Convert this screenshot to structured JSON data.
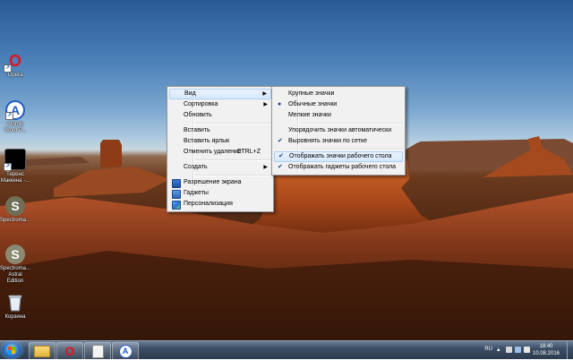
{
  "desktop": {
    "icons": [
      {
        "label": "Opera",
        "icon": "opera-icon"
      },
      {
        "label": "Atomic Word P...",
        "icon": "atomic-word-icon"
      },
      {
        "label": "Теренс Маккена -...",
        "icon": "file-icon"
      },
      {
        "label": "Spectroma...",
        "icon": "spectroma-icon"
      },
      {
        "label": "Spectroma... Astral Edition",
        "icon": "spectroma-astral-icon"
      },
      {
        "label": "Корзина",
        "icon": "recycle-bin-icon"
      }
    ]
  },
  "context_menu": {
    "items": [
      {
        "label": "Вид",
        "submenu": true,
        "highlighted": true
      },
      {
        "label": "Сортировка",
        "submenu": true
      },
      {
        "label": "Обновить"
      },
      {
        "label": "Вставить"
      },
      {
        "label": "Вставить ярлык"
      },
      {
        "label": "Отменить удаление",
        "accel": "CTRL+Z"
      },
      {
        "label": "Создать",
        "submenu": true
      },
      {
        "label": "Разрешение экрана",
        "icon": "display-icon"
      },
      {
        "label": "Гаджеты",
        "icon": "gadgets-icon"
      },
      {
        "label": "Персонализация",
        "icon": "personalization-icon"
      }
    ]
  },
  "view_submenu": {
    "items": [
      {
        "label": "Крупные значки"
      },
      {
        "label": "Обычные значки",
        "mark": "bullet"
      },
      {
        "label": "Мелкие значки"
      },
      {
        "label": "Упорядочить значки автоматически"
      },
      {
        "label": "Выровнять значки по сетке",
        "mark": "check"
      },
      {
        "label": "Отображать значки рабочего стола",
        "mark": "check",
        "highlighted": true
      },
      {
        "label": "Отображать гаджеты  рабочего стола",
        "mark": "check"
      }
    ]
  },
  "taskbar": {
    "pinned": [
      {
        "icon": "explorer-folder-icon"
      },
      {
        "icon": "opera-icon"
      },
      {
        "icon": "document-icon"
      },
      {
        "icon": "atomic-word-icon"
      }
    ],
    "language": "RU",
    "time": "18:40",
    "date": "10.08.2016"
  },
  "colors": {
    "menu_bg": "#f1f1f1",
    "menu_highlight": "#d6e8fb",
    "taskbar": "#2b3a4e",
    "opera_red": "#e0141e",
    "atomic_blue": "#1e5bc6"
  }
}
